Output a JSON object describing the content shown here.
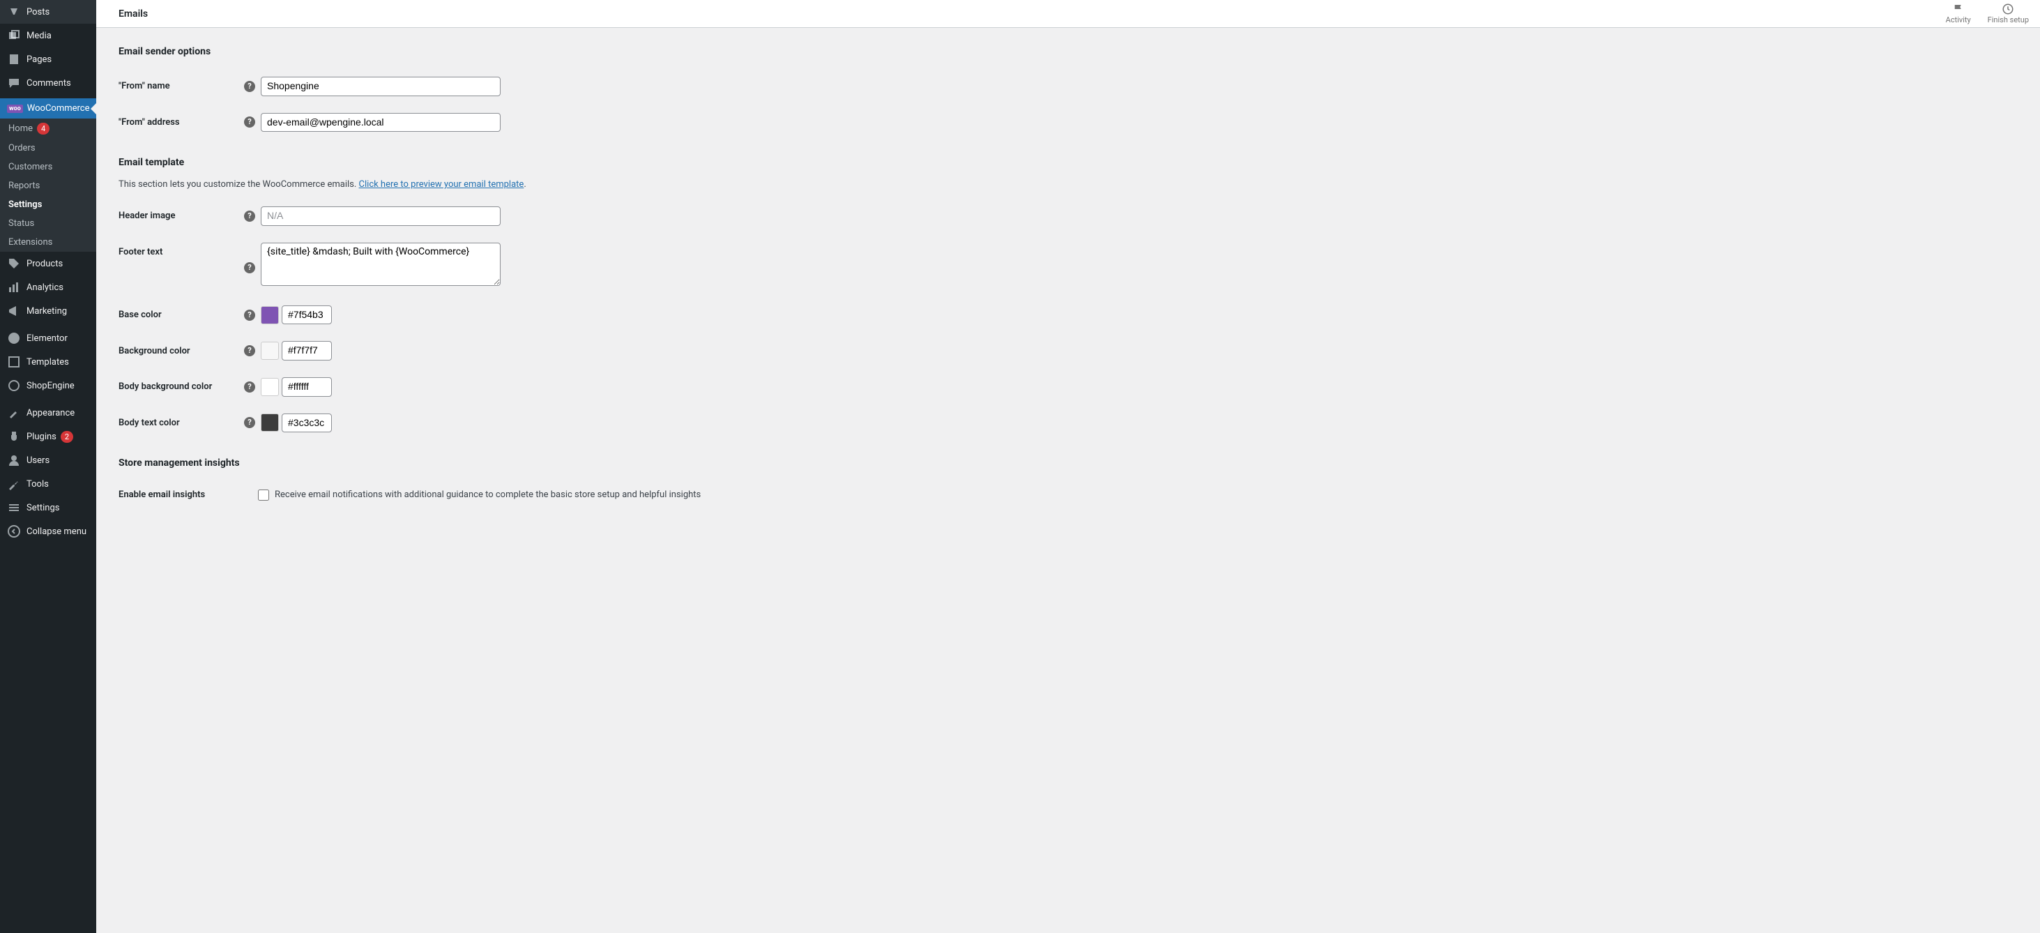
{
  "topbar": {
    "title": "Emails",
    "activity": "Activity",
    "finish_setup": "Finish setup"
  },
  "headings": {
    "sender_options": "Email sender options",
    "email_template": "Email template",
    "store_insights": "Store management insights"
  },
  "desc": {
    "template_pre": "This section lets you customize the WooCommerce emails. ",
    "template_link": "Click here to preview your email template"
  },
  "labels": {
    "from_name": "\"From\" name",
    "from_address": "\"From\" address",
    "header_image": "Header image",
    "footer_text": "Footer text",
    "base_color": "Base color",
    "background_color": "Background color",
    "body_bg_color": "Body background color",
    "body_text_color": "Body text color",
    "enable_insights": "Enable email insights",
    "insights_desc": "Receive email notifications with additional guidance to complete the basic store setup and helpful insights"
  },
  "fields": {
    "from_name": "Shopengine",
    "from_address": "dev-email@wpengine.local",
    "header_image_placeholder": "N/A",
    "footer_text": "{site_title} &mdash; Built with {WooCommerce}",
    "base_color": "#7f54b3",
    "background_color": "#f7f7f7",
    "body_bg_color": "#ffffff",
    "body_text_color": "#3c3c3c"
  },
  "sidebar": {
    "posts": "Posts",
    "media": "Media",
    "pages": "Pages",
    "comments": "Comments",
    "woocommerce": "WooCommerce",
    "products": "Products",
    "analytics": "Analytics",
    "marketing": "Marketing",
    "elementor": "Elementor",
    "templates": "Templates",
    "shopengine": "ShopEngine",
    "appearance": "Appearance",
    "plugins": "Plugins",
    "users": "Users",
    "tools": "Tools",
    "settings": "Settings",
    "collapse": "Collapse menu",
    "plugins_badge": "2"
  },
  "submenu": {
    "home": "Home",
    "home_badge": "4",
    "orders": "Orders",
    "customers": "Customers",
    "reports": "Reports",
    "settings": "Settings",
    "status": "Status",
    "extensions": "Extensions"
  }
}
